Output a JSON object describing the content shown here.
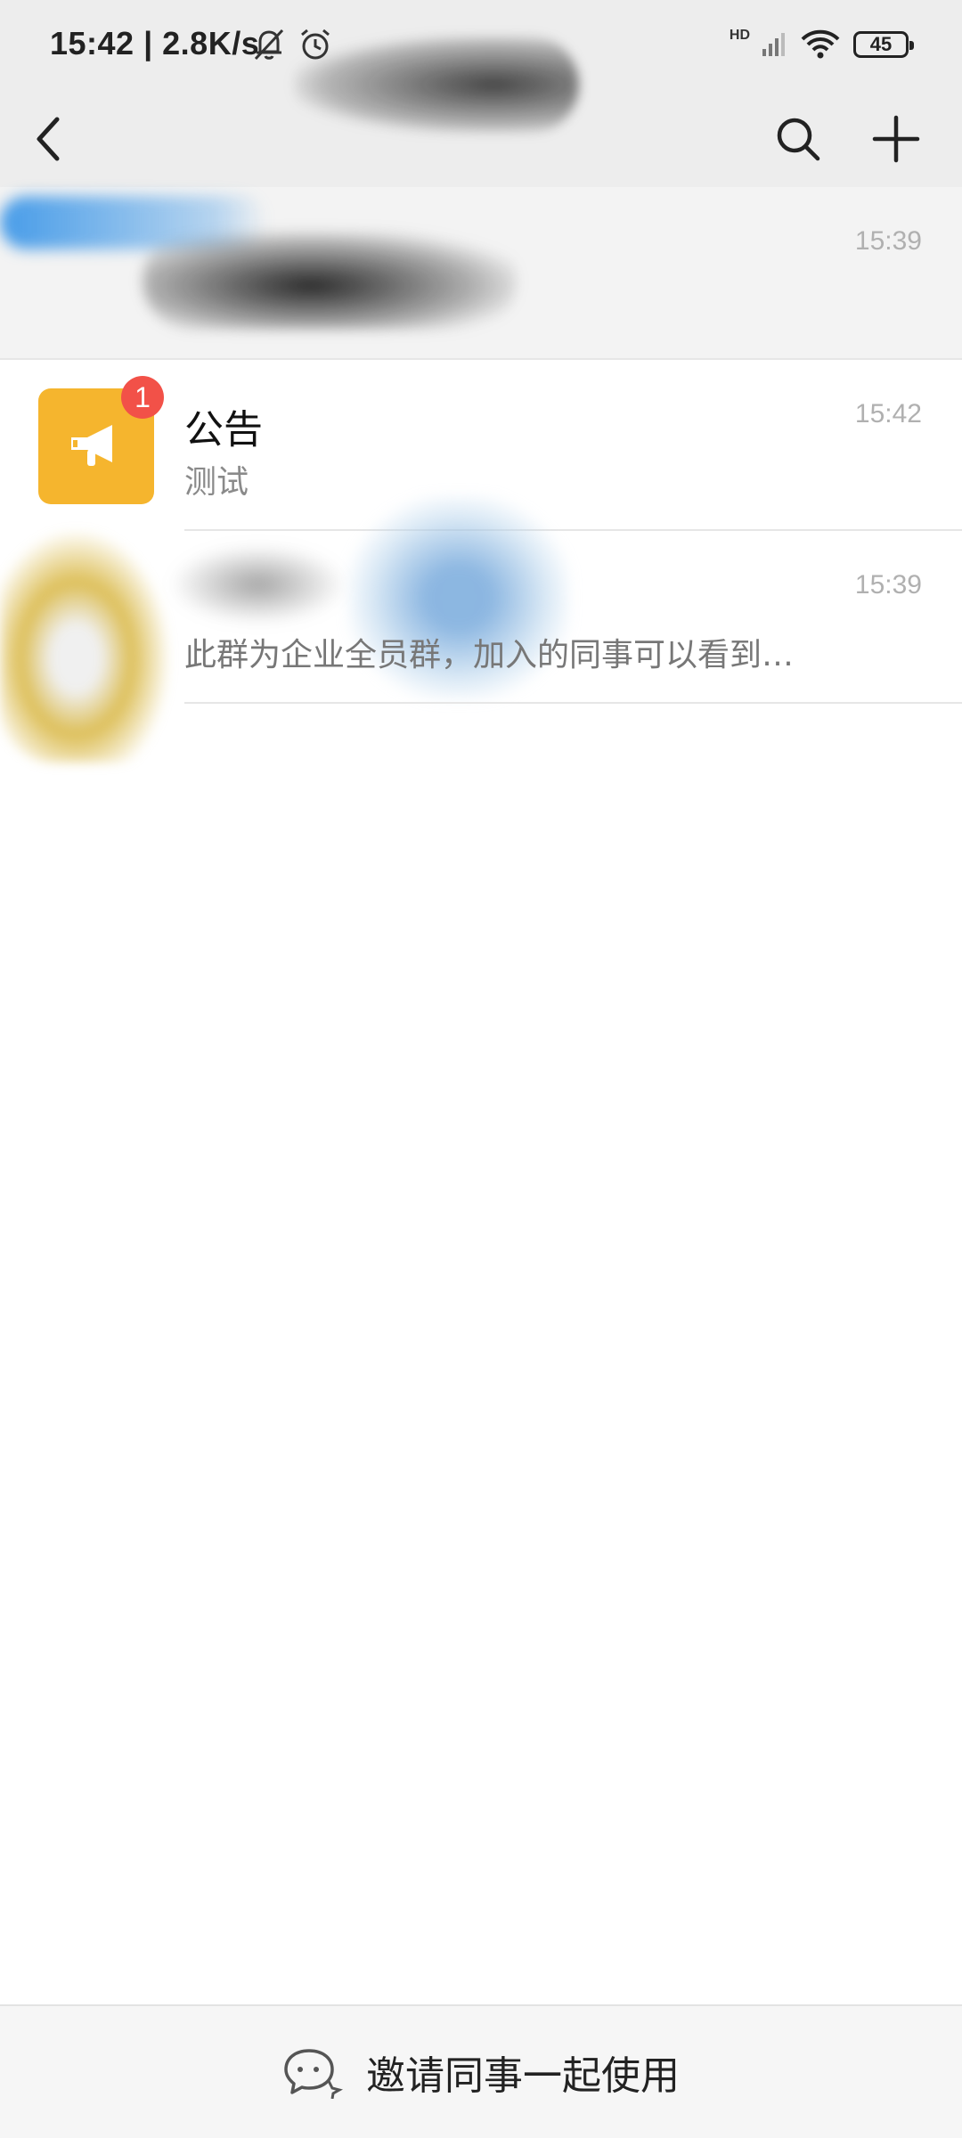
{
  "status_bar": {
    "time": "15:42 | 2.8K/s",
    "network_label": "HD",
    "battery": "45"
  },
  "nav": {
    "back_icon": "chevron-left-icon",
    "search_icon": "search-icon",
    "add_icon": "plus-icon"
  },
  "conversations": [
    {
      "title": "",
      "preview": "",
      "time": "15:39",
      "redacted": true
    },
    {
      "title": "公告",
      "preview": "测试",
      "time": "15:42",
      "unread": "1",
      "avatar_color": "#f5b52e",
      "avatar_icon": "megaphone-icon"
    },
    {
      "title": "",
      "preview": "此群为企业全员群，加入的同事可以看到…",
      "time": "15:39",
      "redacted": true
    }
  ],
  "invite": {
    "label": "邀请同事一起使用",
    "icon": "chat-bubbles-icon"
  },
  "colors": {
    "header_bg": "#ededed",
    "badge": "#f25148",
    "announcement_avatar": "#f5b52e"
  }
}
